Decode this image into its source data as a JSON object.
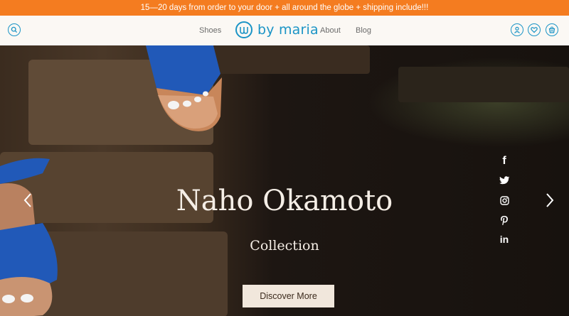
{
  "banner": {
    "text": "15—20 days from order to your door + all around the globe + shipping include!!!"
  },
  "nav": {
    "shoes": "Shoes",
    "about": "About",
    "blog": "Blog"
  },
  "logo": {
    "text": "by maria"
  },
  "hero": {
    "title": "Naho Okamoto",
    "subtitle": "Collection",
    "cta": "Discover More"
  },
  "social": {
    "facebook": "f",
    "linkedin": "in"
  },
  "colors": {
    "banner": "#f47c20",
    "brand": "#1b94c6",
    "header_bg": "#fbf8f4",
    "cta_bg": "#f1e7dc"
  }
}
